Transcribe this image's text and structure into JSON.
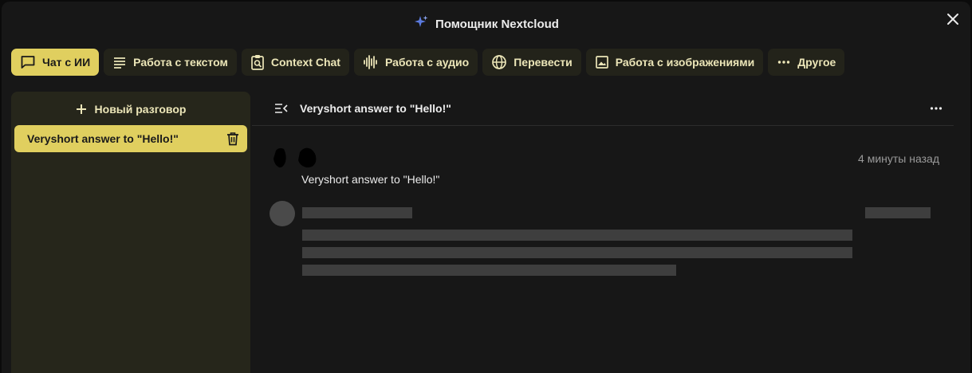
{
  "header": {
    "title": "Помощник Nextcloud",
    "icon": "assistant-sparkle-icon",
    "close_icon": "close-icon"
  },
  "tabs": [
    {
      "label": "Чат с ИИ",
      "icon": "chat-bubble-icon",
      "active": true
    },
    {
      "label": "Работа с текстом",
      "icon": "text-lines-icon",
      "active": false
    },
    {
      "label": "Context Chat",
      "icon": "clipboard-search-icon",
      "active": false
    },
    {
      "label": "Работа с аудио",
      "icon": "waveform-icon",
      "active": false
    },
    {
      "label": "Перевести",
      "icon": "globe-icon",
      "active": false
    },
    {
      "label": "Работа с изображениями",
      "icon": "image-icon",
      "active": false
    },
    {
      "label": "Другое",
      "icon": "more-horizontal-icon",
      "active": false
    }
  ],
  "sidebar": {
    "new_conversation_label": "Новый разговор",
    "conversations": [
      {
        "title": "Veryshort answer to \"Hello!\"",
        "selected": true
      }
    ]
  },
  "main": {
    "title": "Veryshort answer to \"Hello!\"",
    "messages": [
      {
        "role": "user",
        "time": "4 минуты назад",
        "text": "Veryshort answer to \"Hello!\""
      },
      {
        "role": "assistant",
        "loading": true
      }
    ]
  },
  "colors": {
    "accent": "#e0cf5f",
    "background": "#171717",
    "sidebar": "#26261b",
    "tab": "#23231a"
  }
}
